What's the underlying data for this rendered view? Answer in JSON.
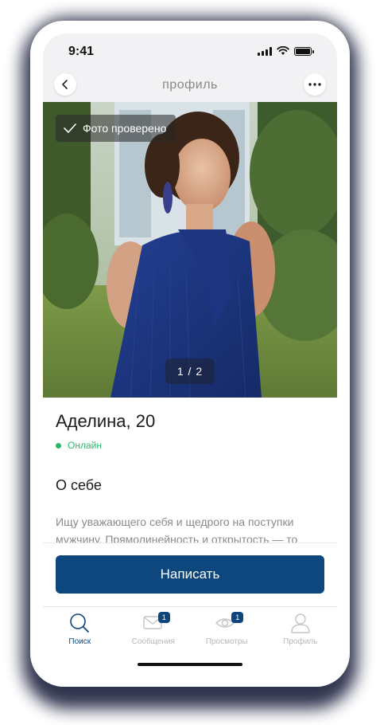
{
  "status_bar": {
    "time": "9:41"
  },
  "nav": {
    "title": "профиль"
  },
  "photo": {
    "verified_label": "Фото проверено",
    "counter": "1 / 2"
  },
  "profile": {
    "name_age": "Аделина, 20",
    "status": "Онлайн",
    "about_title": "О себе",
    "about_text": "Ищу уважающего себя и щедрого на поступки мужчину. Прямолинейность и открытость — то"
  },
  "actions": {
    "write_label": "Написать"
  },
  "tabs": [
    {
      "label": "Поиск",
      "icon": "search-icon",
      "active": true,
      "badge": ""
    },
    {
      "label": "Сообщения",
      "icon": "mail-icon",
      "active": false,
      "badge": "1"
    },
    {
      "label": "Просмотры",
      "icon": "eye-icon",
      "active": false,
      "badge": "1"
    },
    {
      "label": "Профиль",
      "icon": "user-icon",
      "active": false,
      "badge": ""
    }
  ],
  "colors": {
    "accent": "#0e467e",
    "online": "#2fb56a",
    "muted_text": "#8a8a8a"
  }
}
